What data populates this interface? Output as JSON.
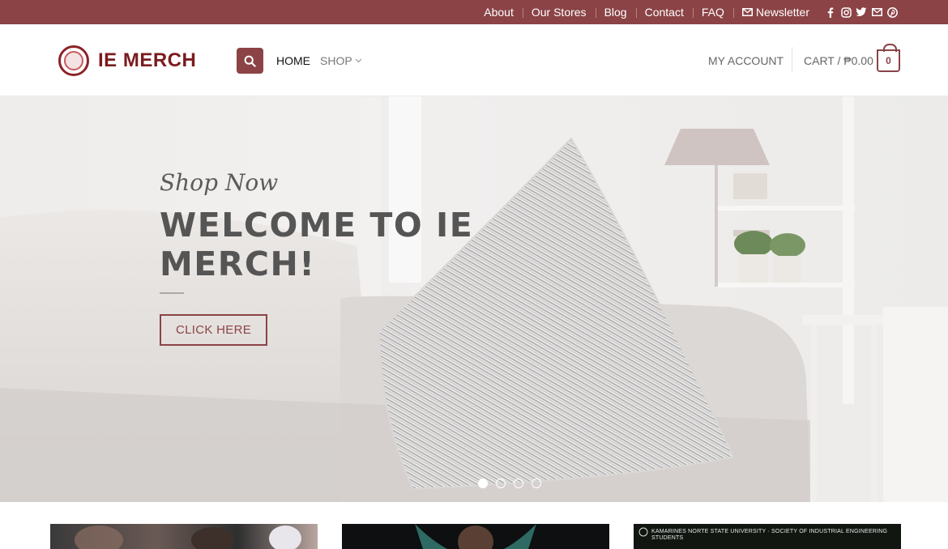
{
  "topbar": {
    "links": [
      "About",
      "Our Stores",
      "Blog",
      "Contact",
      "FAQ"
    ],
    "newsletter": "Newsletter",
    "social": [
      "facebook-icon",
      "instagram-icon",
      "twitter-icon",
      "email-icon",
      "pinterest-icon"
    ],
    "bg_color": "#8b4346"
  },
  "header": {
    "logo_text": "IE MERCH",
    "nav": {
      "home": "HOME",
      "shop": "SHOP"
    },
    "account": "MY ACCOUNT",
    "cart": "CART / ₱0.00",
    "cart_count": "0"
  },
  "hero": {
    "subtitle": "Shop Now",
    "title": "WELCOME TO IE MERCH!",
    "button": "CLICK HERE",
    "slides": 4,
    "active_slide": 1
  },
  "cards": {
    "card3_caption": "KAMARINES NORTE STATE UNIVERSITY · SOCIETY OF INDUSTRIAL ENGINEERING STUDENTS"
  },
  "colors": {
    "accent": "#8b4346",
    "logo": "#7a1c1f"
  }
}
